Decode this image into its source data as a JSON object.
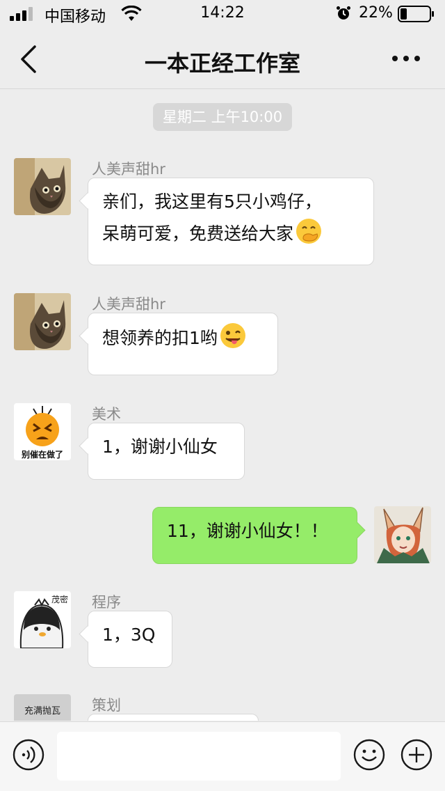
{
  "status_bar": {
    "carrier": "中国移动",
    "time": "14:22",
    "battery": "22%"
  },
  "nav": {
    "title": "一本正经工作室"
  },
  "chat": {
    "timestamp": "星期二 上午10:00",
    "messages": [
      {
        "sender": "人美声甜hr",
        "line1": "亲们，我这里有5只小鸡仔，",
        "line2": "呆萌可爱，免费送给大家",
        "emoji": "face-with-hand-over-mouth-icon",
        "avatar": "cat-avatar"
      },
      {
        "sender": "人美声甜hr",
        "text": "想领养的扣1哟",
        "emoji": "winking-face-with-tongue-icon",
        "avatar": "cat-avatar"
      },
      {
        "sender": "美术",
        "text": "1，谢谢小仙女",
        "avatar": "sticker-avatar",
        "avatar_text": "别催在做了"
      },
      {
        "sender": "me",
        "text": "11，谢谢小仙女！！",
        "avatar": "anime-fox-girl-avatar"
      },
      {
        "sender": "程序",
        "text": "1，3Q",
        "avatar": "penguin-avatar",
        "avatar_text": "茂密"
      },
      {
        "sender": "策划",
        "text": "",
        "avatar": "sticker-avatar",
        "avatar_text": "充满抛瓦"
      }
    ]
  },
  "input": {
    "placeholder": ""
  },
  "colors": {
    "background": "#ededed",
    "my_bubble": "#95ec69",
    "other_bubble": "#ffffff",
    "sender_name": "#8a8a8a"
  }
}
